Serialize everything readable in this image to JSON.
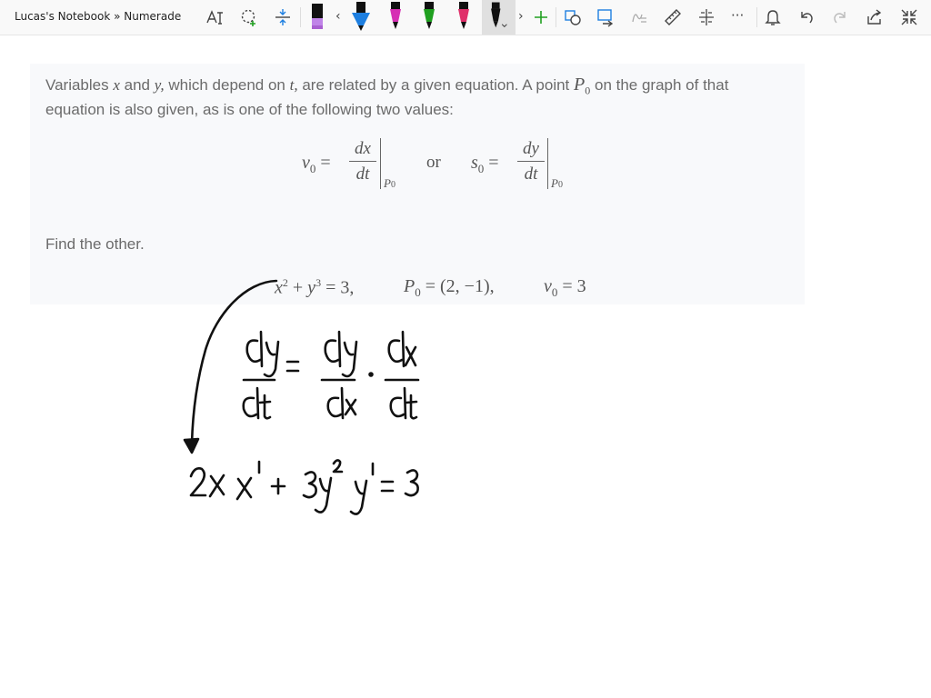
{
  "window": {
    "title": "Lucas's Notebook » Numerade"
  },
  "toolbar": {
    "tools": [
      {
        "name": "text-mode-icon"
      },
      {
        "name": "lasso-select-icon"
      },
      {
        "name": "add-space-icon"
      },
      {
        "name": "highlighter-icon",
        "color": "#a95fd1"
      },
      {
        "name": "pen-icon",
        "color": "#1e7fe0"
      },
      {
        "name": "pen-icon",
        "color": "#d62fb4"
      },
      {
        "name": "pen-icon",
        "color": "#20a020"
      },
      {
        "name": "pen-icon",
        "color": "#e0306a"
      },
      {
        "name": "pen-icon",
        "color": "#111111"
      },
      {
        "name": "plus-icon"
      },
      {
        "name": "ink-to-shape-icon"
      },
      {
        "name": "ink-to-text-icon"
      },
      {
        "name": "ink-to-math-icon"
      },
      {
        "name": "ruler-icon"
      },
      {
        "name": "ink-effects-icon"
      },
      {
        "name": "more-icon"
      },
      {
        "name": "bell-icon"
      },
      {
        "name": "undo-icon"
      },
      {
        "name": "redo-icon"
      },
      {
        "name": "share-icon"
      },
      {
        "name": "collapse-icon"
      }
    ],
    "nav_prev": "‹",
    "nav_next": "›",
    "more": "···"
  },
  "problem": {
    "line1_a": "Variables",
    "var_x": "x",
    "line1_b": "and",
    "var_y": "y,",
    "line1_c": "which depend on",
    "var_t": "t,",
    "line1_d": "are related by a given equation. A point",
    "var_p": "P",
    "var_p_sub": "0",
    "line1_e": "on the graph of that",
    "line2": "equation is also given, as is one of the following two values:",
    "formula": {
      "v0": "v",
      "v0_sub": "0",
      "equals": "=",
      "frac1_num": "dx",
      "frac1_den": "dt",
      "eval_sub1": "P",
      "eval_sub1_idx": "0",
      "or": "or",
      "s0": "s",
      "s0_sub": "0",
      "frac2_num": "dy",
      "frac2_den": "dt",
      "eval_sub2": "P",
      "eval_sub2_idx": "0"
    },
    "find": "Find the other.",
    "given": {
      "eq_x": "x",
      "eq_x_pow": "2",
      "eq_plus": "+",
      "eq_y": "y",
      "eq_y_pow": "3",
      "eq_rhs": "= 3,",
      "p0": "P",
      "p0_sub": "0",
      "p0_val": "= (2, −1),",
      "v0": "v",
      "v0_sub": "0",
      "v0_val": "= 3"
    }
  },
  "colors": {
    "ink": "#111111",
    "problem_bg": "#f8f9fb",
    "text": "#6b6b6b"
  }
}
